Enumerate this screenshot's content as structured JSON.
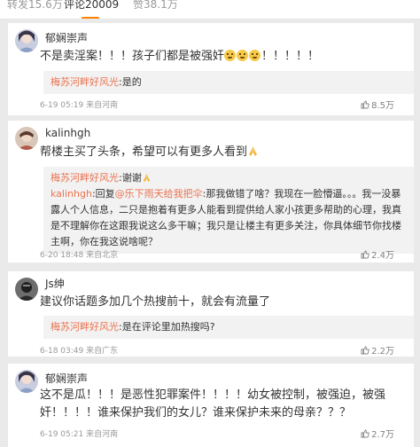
{
  "tabs": [
    {
      "label": "转发15.6万"
    },
    {
      "label": "评论20009"
    },
    {
      "label": "赞38.1万"
    }
  ],
  "comments": [
    {
      "username": "郁娴崇声",
      "text_before": "不是卖淫案！！！孩子们都是被强奸",
      "text_after": "！！！！！",
      "reply": {
        "name": "梅苏河畔好风光",
        "text": ":是的"
      },
      "meta": "6-19 05:19 来自河南",
      "likes": "8.5万"
    },
    {
      "username": "kalinhgh",
      "text": "帮楼主买了头条，希望可以有更多人看到",
      "replies": [
        {
          "name": "梅苏河畔好风光",
          "text": ":谢谢"
        },
        {
          "name": "kalinhgh",
          "text_prefix": ":回复",
          "at": "@乐下雨天给我把伞",
          "text": ":那我做错了啥？我现在一脸懵逼。。。我一没暴露人个人信息，二只是抱着有更多人能看到提供给人家小孩更多帮助的心理，我真是不理解你在这跟我说这么多干嘛；我只是让楼主有更多关注，你具体细节你找楼主啊，你在我这说啥呢？"
        }
      ],
      "meta": "6-20 18:48 来自北京",
      "likes": "2.4万"
    },
    {
      "username": "Js绅",
      "text": "建议你话题多加几个热搜前十，就会有流量了",
      "reply": {
        "name": "梅苏河畔好风光",
        "text": ":是在评论里加热搜吗?"
      },
      "meta": "6-18 03:49 来自广东",
      "likes": "2.2万"
    },
    {
      "username": "郁娴崇声",
      "text": "这不是瓜！！！是恶性犯罪案件！！！！幼女被控制，被强迫，被强奸！！！！谁来保护我们的女儿？谁来保护未来的母亲？？？",
      "meta": "6-19 05:21 来自河南",
      "likes": "2.7万"
    }
  ],
  "colors": {
    "link": "#eb7350",
    "accent": "#ff8200",
    "background": "#eaeaea"
  },
  "icons": [
    "thumbs-up-icon",
    "grin-emoji-icon",
    "pray-emoji-icon",
    "avatar"
  ]
}
